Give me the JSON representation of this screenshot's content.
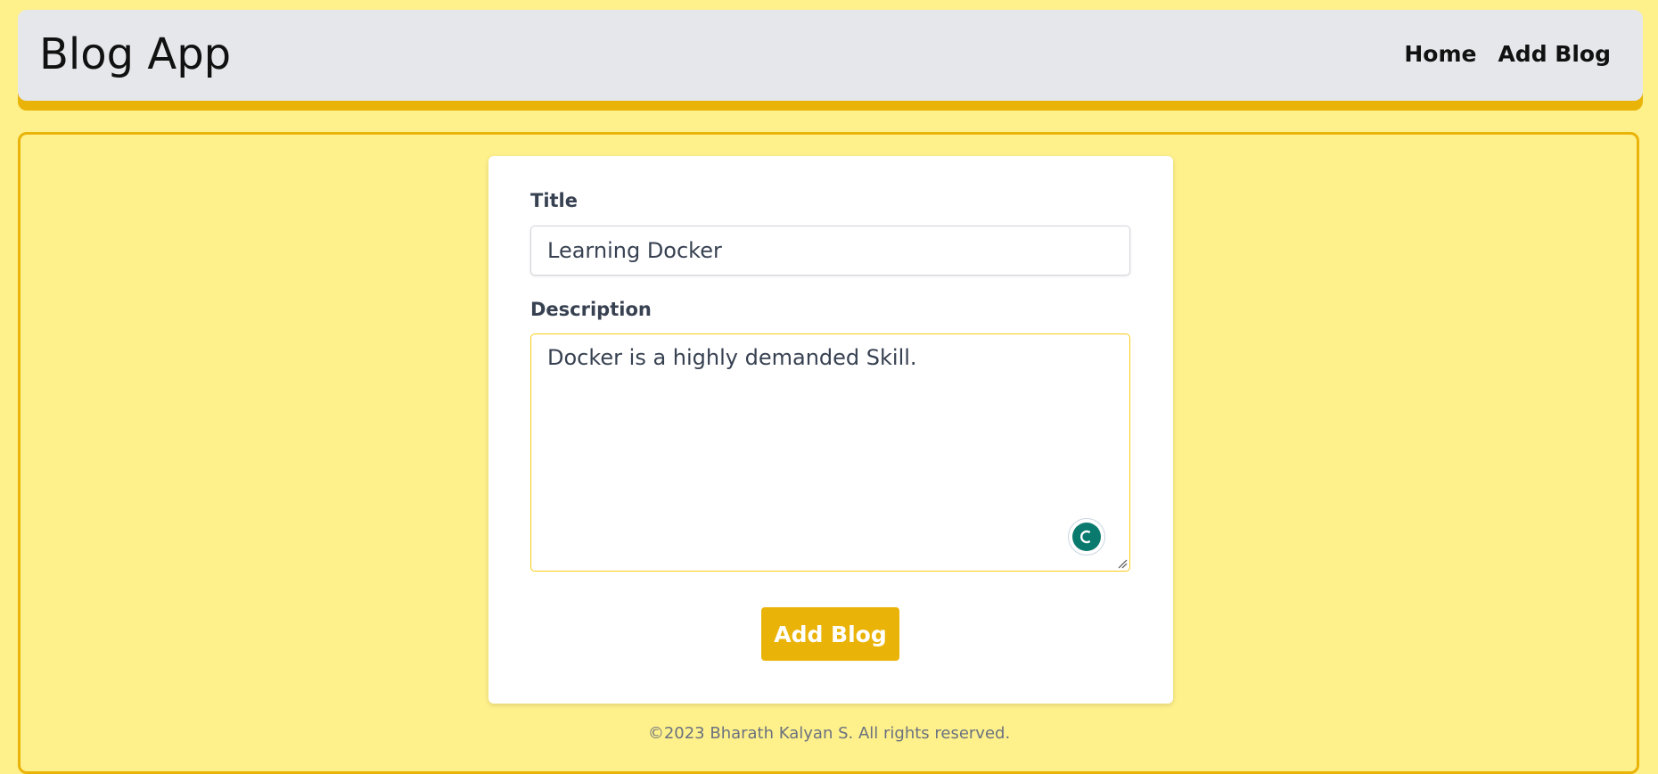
{
  "header": {
    "brand": "Blog App",
    "nav": [
      {
        "label": "Home"
      },
      {
        "label": "Add Blog"
      }
    ]
  },
  "form": {
    "title_label": "Title",
    "title_value": "Learning Docker",
    "description_label": "Description",
    "description_value": "Docker is a highly demanded Skill.",
    "submit_label": "Add Blog"
  },
  "icons": {
    "grammar_assistant": "grammar-assistant-icon",
    "resize_handle": "resize-handle-icon"
  },
  "colors": {
    "page_background": "#fef08a",
    "header_background": "#e5e7eb",
    "accent": "#eab308",
    "assistant_icon": "#0b7a6e"
  },
  "footer": {
    "text": "©2023 Bharath Kalyan S. All rights reserved."
  }
}
